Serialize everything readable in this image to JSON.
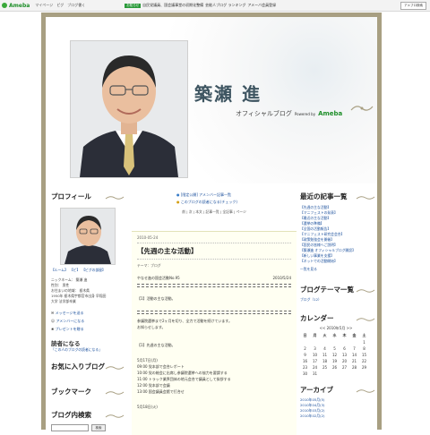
{
  "top_bar": {
    "logo_text": "Ameba",
    "links": [
      "マイページ",
      "ピグ",
      "ブログ書く"
    ],
    "notice_tag": "お知らせ",
    "notice_text": "自民党議員、国会議事堂の初期化整備",
    "notice_more": "芸能人ブログ ランキング",
    "notice_more2": "アメーバ会員登録",
    "button": "アメブロ検索"
  },
  "header": {
    "title": "築瀬 進",
    "subtitle": "オフィシャルブログ",
    "powered_by": "Powered by",
    "ameba": "Ameba"
  },
  "left": {
    "profile_title": "プロフィール",
    "profile_links": [
      "【ルーム】",
      "【ピ】",
      "【ピグの部屋】"
    ],
    "bio_lines": [
      "ニックネーム： 築瀬 進",
      "性別： 男性",
      "お住まいの地域： 栃木県",
      "1950年 栃木県宇都宮市出身 早稲田",
      "大学 法学部卒業"
    ],
    "actions": [
      "メッセージを送る",
      "アメンバーになる",
      "プレゼントを贈る"
    ],
    "reader_title": "読者になる",
    "reader_text": "「この人のブログの読者になる」",
    "fav_title": "お気に入りブログ",
    "bookmark_title": "ブックマーク",
    "search_title": "ブログ内検索",
    "search_button": "検索"
  },
  "content": {
    "member_line1": "[限定公開] アメンバー記事一覧",
    "member_line2": "このブログの読者になる(チェック)",
    "pager": "前 | 次 | 本文 | 記事一覧 | 全記事 | ページ",
    "date": "2010-05-24",
    "entry_title": "【先週の主な活動】",
    "theme": "テーマ：ブログ",
    "mail_title": "やなせ進の国会活動No.95",
    "mail_date": "2010/5/24",
    "activity_header": "【1】活動の主な活動。",
    "body1": "参議院選挙まで2ヶ月を切り、全力で活動を続けています。",
    "body2": "お知らせします。",
    "section2": "【1】先週の主な活動。",
    "schedule": [
      "5月17日(月)",
      "09:00 党本部で会合レポート",
      "10:00 党の総会に出席し参議院選挙への協力を要請する",
      "11:00 トラック業界団体の地元会合で議員として挨拶する",
      "12:00 党本部で会議",
      "13:00 国会議員会館で打合せ"
    ],
    "schedule_tail": "5月18日(火)"
  },
  "right": {
    "recent_title": "最近の記事一覧",
    "recent": [
      "【先週の主な活動】",
      "【マニフェストの発表】",
      "【最近の主な活動】",
      "【選挙の準備】",
      "【全国の活動報告】",
      "【マニフェスト研究会会合】",
      "【政策勉強会を開催】",
      "【国民の皆様へご説明】",
      "【築瀬進 オフィシャルブログ開設】",
      "【新しい事業を支援】",
      "【ネットでの活動開始】"
    ],
    "recent_more": "一覧を見る",
    "theme_title": "ブログテーマ一覧",
    "theme_item": "ブログ（12）",
    "calendar_title": "カレンダー",
    "calendar_month": "<< 2010年5月 >>",
    "dow": [
      "日",
      "月",
      "火",
      "水",
      "木",
      "金",
      "土"
    ],
    "days": [
      "",
      "",
      "",
      "",
      "",
      "",
      "1",
      "2",
      "3",
      "4",
      "5",
      "6",
      "7",
      "8",
      "9",
      "10",
      "11",
      "12",
      "13",
      "14",
      "15",
      "16",
      "17",
      "18",
      "19",
      "20",
      "21",
      "22",
      "23",
      "24",
      "25",
      "26",
      "27",
      "28",
      "29",
      "30",
      "31",
      "",
      "",
      "",
      "",
      ""
    ],
    "archive_title": "アーカイブ",
    "archive": [
      "2010年05月(5)",
      "2010年04月(3)",
      "2010年03月(2)",
      "2010年02月(2)"
    ]
  }
}
